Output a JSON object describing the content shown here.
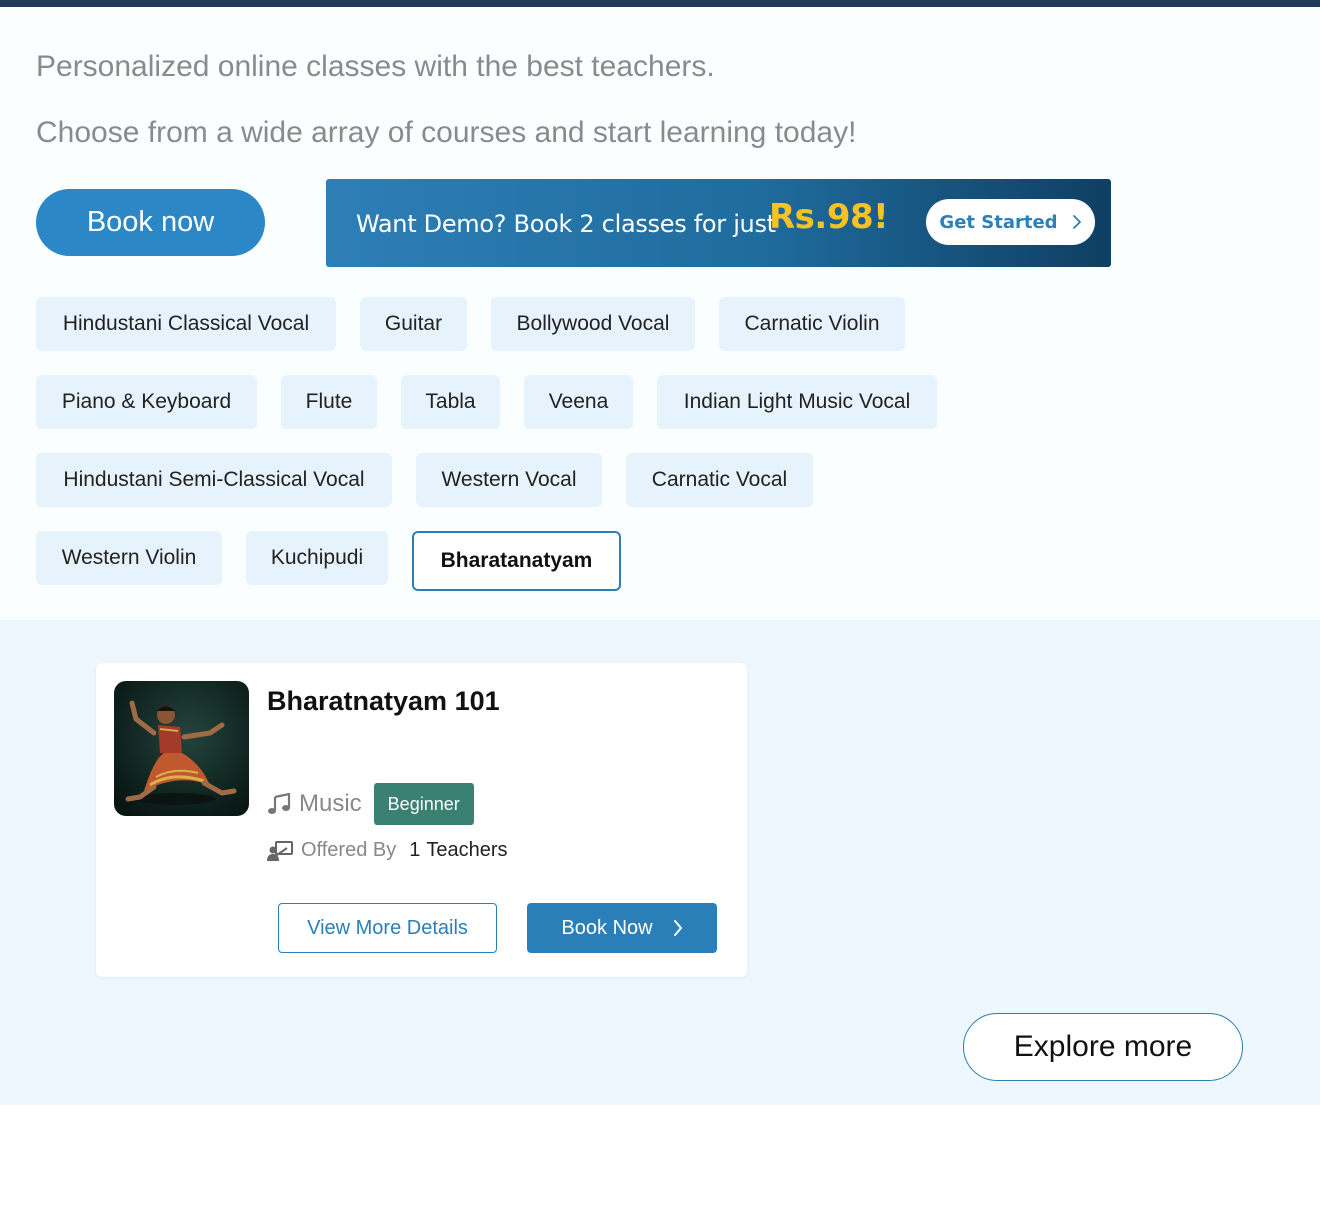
{
  "hero": {
    "tagline_1": "Personalized online classes with the best teachers.",
    "tagline_2": "Choose from a wide array of courses and start learning today!",
    "book_now_label": "Book now",
    "demo_banner": {
      "text": "Want Demo? Book 2 classes for just",
      "price": "Rs.98!",
      "cta_label": "Get Started"
    }
  },
  "categories": [
    "Hindustani Classical Vocal",
    "Guitar",
    "Bollywood Vocal",
    "Carnatic Violin",
    "Piano & Keyboard",
    "Flute",
    "Tabla",
    "Veena",
    "Indian Light Music Vocal",
    "Hindustani Semi-Classical Vocal",
    "Western Vocal",
    "Carnatic Vocal",
    "Western Violin",
    "Kuchipudi",
    "Bharatanatyam"
  ],
  "selected_category": "Bharatanatyam",
  "course_card": {
    "title": "Bharatnatyam 101",
    "category_icon": "music-note-icon",
    "category": "Music",
    "level": "Beginner",
    "offered_by_icon": "teacher-icon",
    "offered_by_label": "Offered By",
    "teacher_count": "1",
    "teachers_label": "Teachers",
    "view_details_label": "View More Details",
    "book_now_label": "Book Now"
  },
  "explore_more_label": "Explore more",
  "colors": {
    "primary": "#2b87c5",
    "chip_bg": "#e6f3fc",
    "section_bg": "#eef7fd",
    "badge_green": "#3a8073",
    "price_yellow": "#f7c324"
  }
}
